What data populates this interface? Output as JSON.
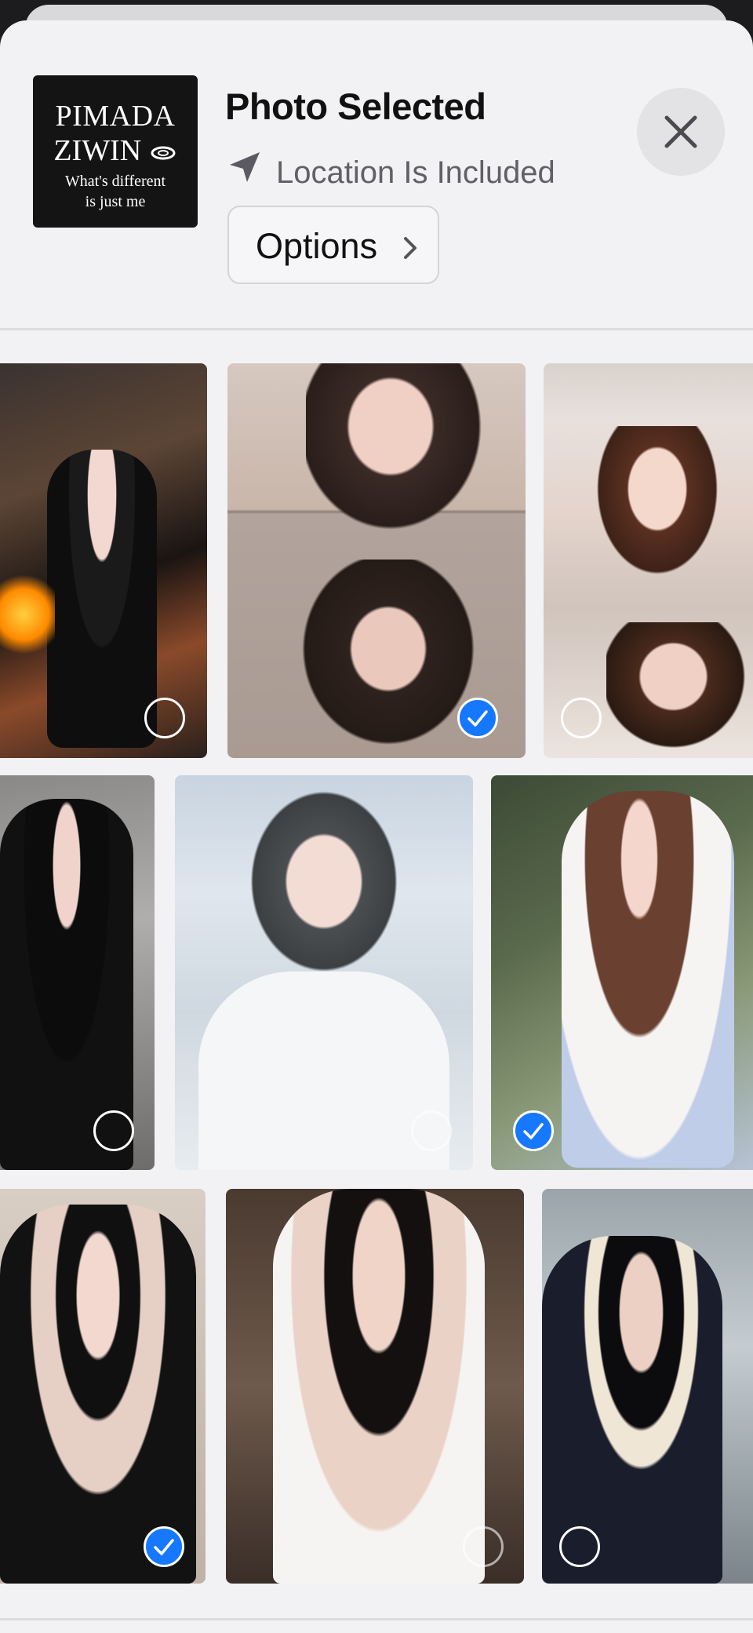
{
  "header": {
    "thumbnail_text": [
      "PIMADA",
      "ZIWIN",
      "What's different",
      "is just me"
    ],
    "title": "Photo Selected",
    "location_text": "Location Is Included",
    "options_label": "Options",
    "icons": {
      "location": "location-arrow-icon",
      "options": "chevron-right-icon",
      "close": "close-icon"
    }
  },
  "grid": {
    "rows": [
      [
        {
          "selected": false
        },
        {
          "selected": true
        },
        {
          "selected": false
        }
      ],
      [
        {
          "selected": false
        },
        {
          "selected": false
        },
        {
          "selected": true
        }
      ],
      [
        {
          "selected": false
        },
        {
          "selected": false
        },
        {
          "selected": false
        }
      ]
    ]
  },
  "colors": {
    "accent": "#1677ff",
    "sheet": "#f2f2f4"
  }
}
